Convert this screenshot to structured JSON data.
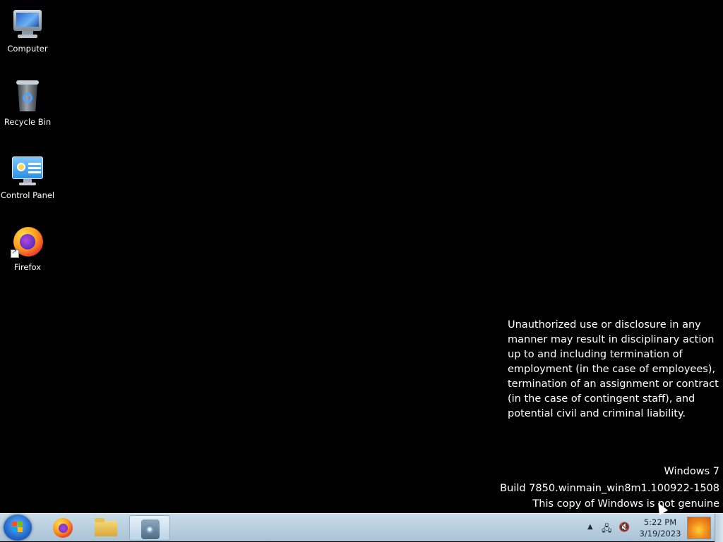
{
  "desktop": {
    "icons": [
      {
        "label": "Computer",
        "icon": "computer-icon"
      },
      {
        "label": "Recycle Bin",
        "icon": "recycle-bin-icon"
      },
      {
        "label": "Control Panel",
        "icon": "control-panel-icon"
      },
      {
        "label": "Firefox",
        "icon": "firefox-icon"
      }
    ],
    "notice": "Unauthorized use or disclosure in any manner may result in disciplinary action up to and including termination of employment (in the case of employees), termination of an assignment or contract (in the case of contingent staff), and potential civil and criminal liability.",
    "watermark": {
      "line1": "Windows 7",
      "line2": "Build 7850.winmain_win8m1.100922-1508",
      "line3": "This copy of Windows is not genuine"
    }
  },
  "taskbar": {
    "start_button": "windows-start-orb",
    "pinned": [
      {
        "name": "Firefox",
        "icon": "firefox-icon",
        "active": false
      },
      {
        "name": "Windows Explorer",
        "icon": "folder-icon",
        "active": false
      },
      {
        "name": "Media",
        "icon": "media-player-icon",
        "active": true
      }
    ],
    "tray_icons": [
      "show-hidden-icons-arrow",
      "network-icon",
      "volume-muted-icon"
    ],
    "clock": {
      "time": "5:22 PM",
      "date": "3/19/2023"
    }
  },
  "colors": {
    "desktop_background": "#000000",
    "taskbar": "#b9d0e2"
  }
}
